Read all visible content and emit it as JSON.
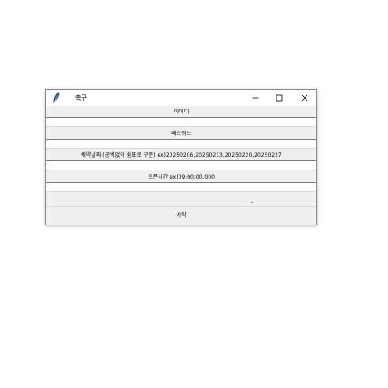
{
  "window": {
    "title": "축구",
    "controls": {
      "minimize_icon": "minimize-icon",
      "maximize_icon": "maximize-icon",
      "close_icon": "close-icon"
    }
  },
  "form": {
    "id_label": "아이디",
    "id_value": "",
    "password_label": "패스워드",
    "password_value": "",
    "dates_label": "예약날짜 (공백없이 쉼표로 구분) ex)20250206,20250213,20250220,20250227",
    "dates_value": "",
    "time_label": "오픈시간 ex)09:00:00.000",
    "time_value": ""
  },
  "start_button": {
    "label": "시작"
  },
  "colors": {
    "window_bg": "#f0f0f0",
    "entry_bg": "#ffffff",
    "titlebar_bg": "#ffffff"
  }
}
